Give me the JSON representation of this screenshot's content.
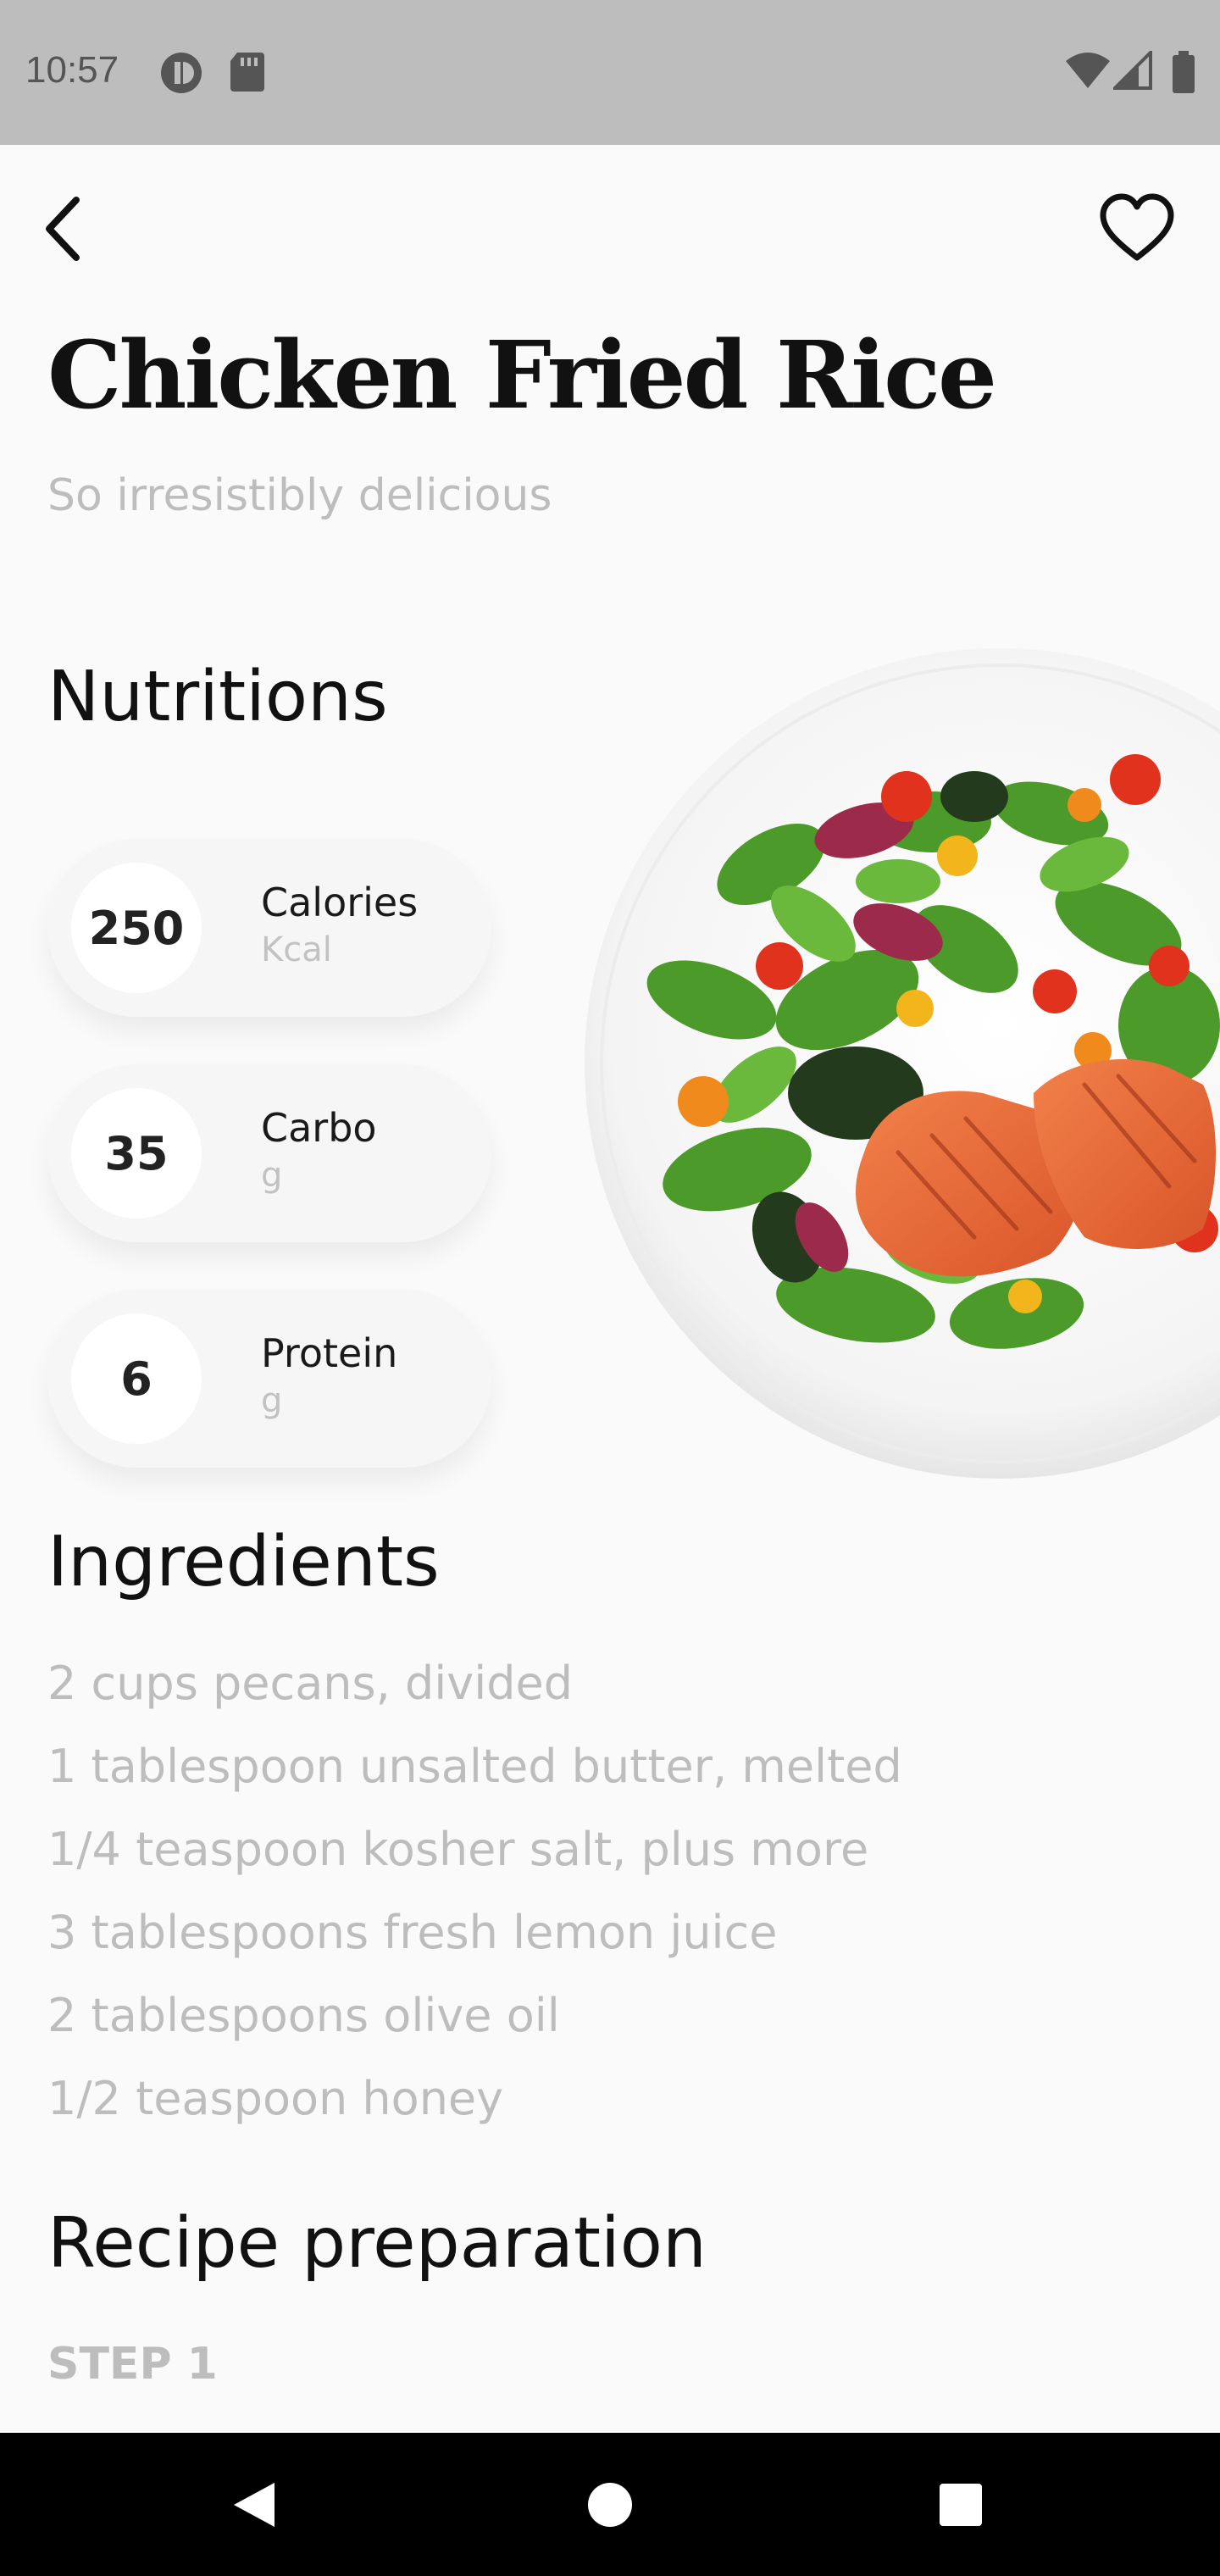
{
  "status_bar": {
    "time": "10:57",
    "icons": [
      "app-notification-icon",
      "sd-card-icon",
      "wifi-icon",
      "cell-signal-icon",
      "battery-icon"
    ]
  },
  "header": {
    "back_icon": "back-arrow-icon",
    "favorite_icon": "heart-outline-icon"
  },
  "recipe": {
    "title": "Chicken Fried Rice",
    "subtitle": "So irresistibly delicious"
  },
  "nutritions": {
    "heading": "Nutritions",
    "items": [
      {
        "value": "250",
        "name": "Calories",
        "unit": "Kcal"
      },
      {
        "value": "35",
        "name": "Carbo",
        "unit": "g"
      },
      {
        "value": "6",
        "name": "Protein",
        "unit": "g"
      }
    ]
  },
  "ingredients": {
    "heading": "Ingredients",
    "items": [
      "2 cups pecans, divided",
      "1 tablespoon unsalted butter, melted",
      "1/4 teaspoon kosher salt, plus more",
      "3 tablespoons fresh lemon juice",
      "2 tablespoons olive oil",
      "1/2 teaspoon honey"
    ]
  },
  "preparation": {
    "heading": "Recipe preparation",
    "step_label": "STEP 1"
  },
  "nav_bar": {
    "icons": [
      "back-triangle-icon",
      "home-circle-icon",
      "recents-square-icon"
    ]
  },
  "colors": {
    "background": "#fafafa",
    "status_bar": "#bdbdbd",
    "muted_text": "#bdbdbd",
    "heading_text": "#111111"
  }
}
